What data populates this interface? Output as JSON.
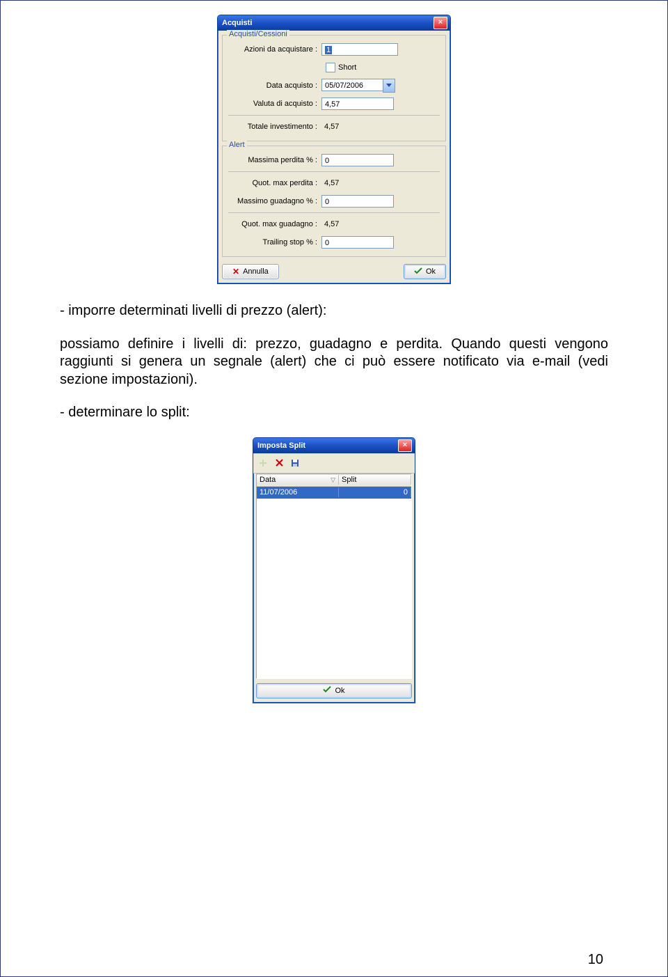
{
  "dialog1": {
    "title": "Acquisti",
    "group1_legend": "Acquisti/Cessioni",
    "azioni_label": "Azioni da acquistare :",
    "azioni_value": "1",
    "short_label": "Short",
    "data_acq_label": "Data acquisto :",
    "data_acq_value": "05/07/2006",
    "valuta_label": "Valuta di acquisto :",
    "valuta_value": "4,57",
    "totale_label": "Totale investimento :",
    "totale_value": "4,57",
    "group2_legend": "Alert",
    "max_perdita_label": "Massima perdita % :",
    "max_perdita_value": "0",
    "quot_perdita_label": "Quot. max perdita :",
    "quot_perdita_value": "4,57",
    "max_guad_label": "Massimo guadagno % :",
    "max_guad_value": "0",
    "quot_guad_label": "Quot. max guadagno :",
    "quot_guad_value": "4,57",
    "trailing_label": "Trailing stop % :",
    "trailing_value": "0",
    "annulla": "Annulla",
    "ok": "Ok"
  },
  "doc": {
    "bullet1_prefix": "-  imporre determinati  livelli di prezzo (alert):",
    "paragraph": "possiamo definire i livelli di: prezzo, guadagno e perdita. Quando questi vengono raggiunti si genera un segnale (alert) che ci può essere notificato via e-mail (vedi sezione impostazioni).",
    "bullet2": "-   determinare lo split:"
  },
  "dialog2": {
    "title": "Imposta Split",
    "col_data": "Data",
    "col_split": "Split",
    "row_date": "11/07/2006",
    "row_split": "0",
    "ok": "Ok"
  },
  "page_number": "10"
}
